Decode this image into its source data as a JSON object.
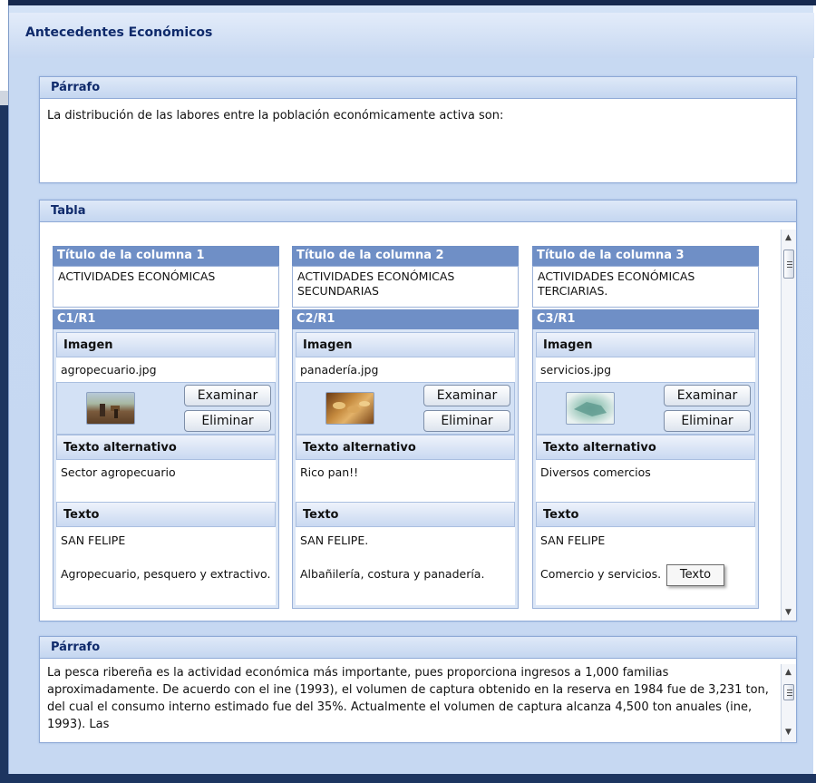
{
  "window": {
    "title": "Antecedentes Económicos"
  },
  "paragraph1": {
    "header": "Párrafo",
    "text": "La distribución de las labores entre la población económicamente activa son:"
  },
  "table": {
    "header": "Tabla",
    "columns": [
      {
        "title_label": "Título de la columna 1",
        "title_value": "ACTIVIDADES ECONÓMICAS",
        "cell_label": "C1/R1",
        "image_label": "Imagen",
        "image_file": "agropecuario.jpg",
        "browse_label": "Examinar",
        "delete_label": "Eliminar",
        "alt_label": "Texto alternativo",
        "alt_value": "Sector agropecuario",
        "text_label": "Texto",
        "text_line1": "SAN FELIPE",
        "text_line2": "Agropecuario, pesquero y extractivo."
      },
      {
        "title_label": "Título de la columna 2",
        "title_value": "ACTIVIDADES ECONÓMICAS SECUNDARIAS",
        "cell_label": "C2/R1",
        "image_label": "Imagen",
        "image_file": "panadería.jpg",
        "browse_label": "Examinar",
        "delete_label": "Eliminar",
        "alt_label": "Texto alternativo",
        "alt_value": "Rico pan!!",
        "text_label": "Texto",
        "text_line1": "SAN FELIPE.",
        "text_line2": "Albañilería, costura y panadería."
      },
      {
        "title_label": "Título de la columna 3",
        "title_value": "ACTIVIDADES ECONÓMICAS TERCIARIAS.",
        "cell_label": "C3/R1",
        "image_label": "Imagen",
        "image_file": "servicios.jpg",
        "browse_label": "Examinar",
        "delete_label": "Eliminar",
        "alt_label": "Texto alternativo",
        "alt_value": "Diversos comercios",
        "text_label": "Texto",
        "text_line1": "SAN FELIPE",
        "text_line2": "Comercio y servicios."
      }
    ]
  },
  "tooltip": {
    "text": "Texto"
  },
  "paragraph2": {
    "header": "Párrafo",
    "text": "La pesca ribereña es la actividad económica más importante, pues proporciona ingresos a 1,000 familias aproximadamente. De acuerdo con el ine (1993), el volumen de captura obtenido en la reserva en 1984 fue de 3,231 ton, del cual el consumo interno estimado fue del 35%. Actualmente el volumen de captura alcanza 4,500 ton anuales (ine, 1993). Las"
  },
  "icons": {
    "scroll_up": "scroll-up-icon",
    "scroll_down": "scroll-down-icon",
    "thumb_1": "agriculture-photo-icon",
    "thumb_2": "bread-photo-icon",
    "thumb_3": "services-photo-icon"
  }
}
